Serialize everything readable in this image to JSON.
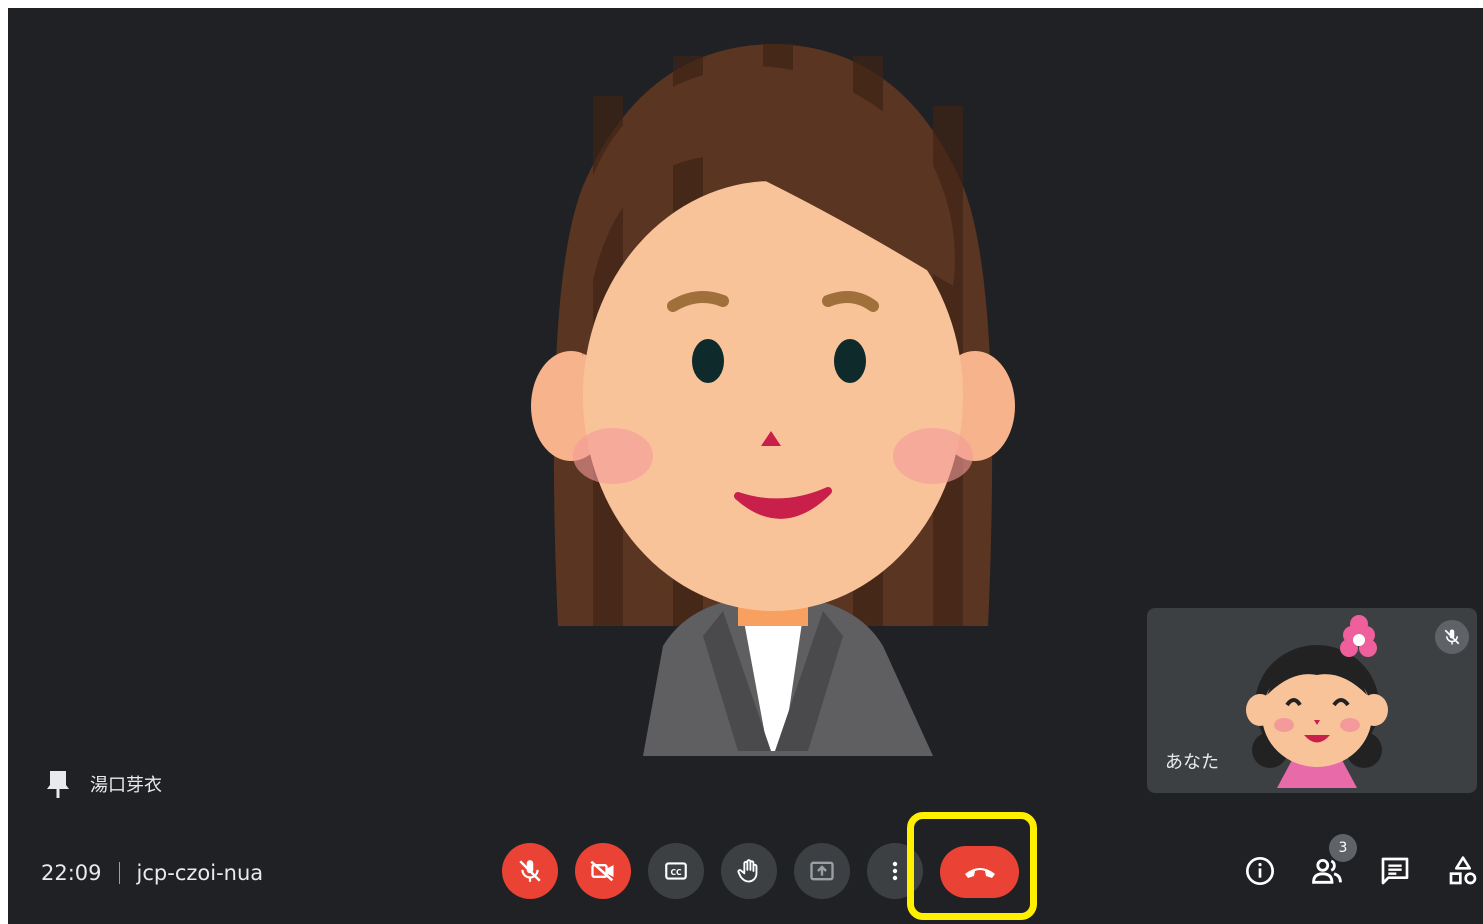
{
  "participant": {
    "name": "湯口芽衣"
  },
  "self": {
    "label": "あなた"
  },
  "meeting": {
    "time": "22:09",
    "code": "jcp-czoi-nua"
  },
  "controls": [
    {
      "name": "mic-off-button",
      "icon": "mic-off-icon",
      "state": "red"
    },
    {
      "name": "camera-off-button",
      "icon": "videocam-off-icon",
      "state": "red"
    },
    {
      "name": "captions-button",
      "icon": "closed-caption-icon",
      "state": "gray"
    },
    {
      "name": "raise-hand-button",
      "icon": "hand-icon",
      "state": "gray"
    },
    {
      "name": "present-button",
      "icon": "present-icon",
      "state": "dim"
    },
    {
      "name": "more-options-button",
      "icon": "more-vert-icon",
      "state": "gray"
    },
    {
      "name": "leave-call-button",
      "icon": "call-end-icon",
      "state": "red"
    }
  ],
  "right_panel": {
    "participants_count": "3"
  },
  "colors": {
    "background": "#202124",
    "tile": "#3c4043",
    "danger": "#ea4335",
    "highlight": "#fff000"
  }
}
